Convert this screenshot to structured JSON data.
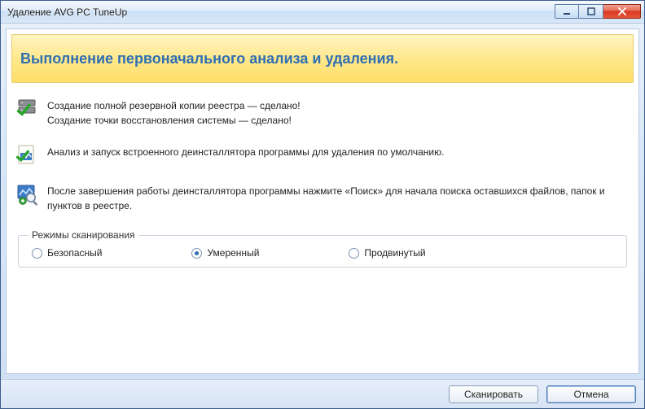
{
  "window": {
    "title": "Удаление AVG PC TuneUp"
  },
  "banner": {
    "title": "Выполнение первоначального анализа и удаления."
  },
  "steps": {
    "backup": {
      "line1": "Создание полной резервной копии реестра — сделано!",
      "line2": "Создание точки восстановления системы — сделано!"
    },
    "analyze": "Анализ и запуск встроенного деинсталлятора программы для удаления по умолчанию.",
    "postsearch": "После завершения работы деинсталлятора программы нажмите «Поиск» для начала поиска оставшихся файлов, папок и пунктов в реестре."
  },
  "scan_modes": {
    "legend": "Режимы сканирования",
    "options": {
      "safe": "Безопасный",
      "moderate": "Умеренный",
      "advanced": "Продвинутый"
    },
    "selected": "moderate"
  },
  "footer": {
    "scan": "Сканировать",
    "cancel": "Отмена"
  }
}
